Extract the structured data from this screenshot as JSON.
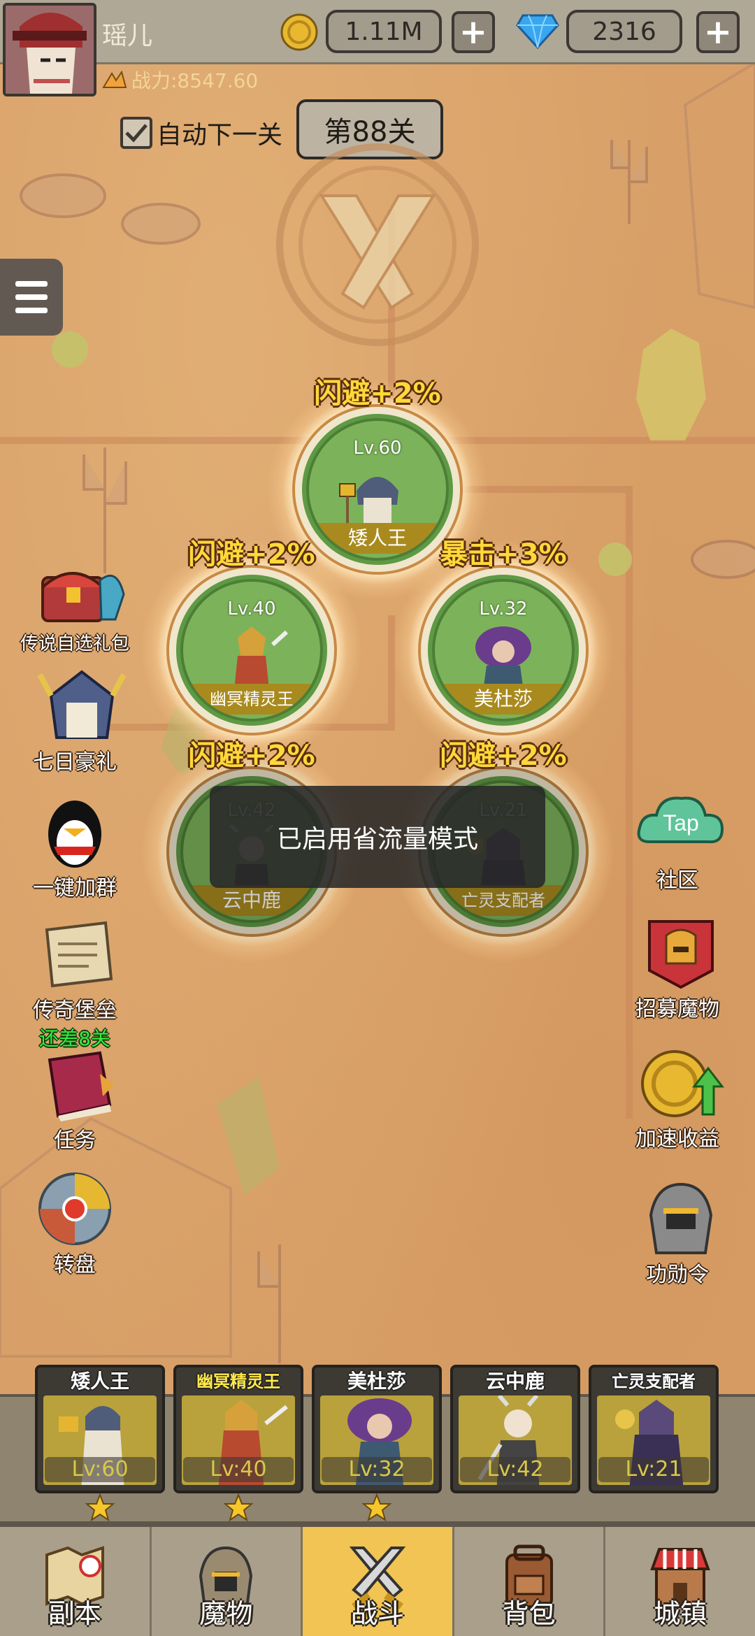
{
  "player": {
    "name": "瑶儿",
    "power_label": "战力:8547.60"
  },
  "currency": {
    "gold": "1.11M",
    "gems": "2316",
    "plus": "+"
  },
  "stage": {
    "auto_next_label": "自动下一关",
    "auto_next_checked": true,
    "current": "第88关"
  },
  "formation": [
    {
      "buff": "闪避+2%",
      "level": "Lv.60",
      "name": "矮人王"
    },
    {
      "buff": "闪避+2%",
      "level": "Lv.40",
      "name": "幽冥精灵王"
    },
    {
      "buff": "暴击+3%",
      "level": "Lv.32",
      "name": "美杜莎"
    },
    {
      "buff": "闪避+2%",
      "level": "Lv.42",
      "name": "云中鹿"
    },
    {
      "buff": "闪避+2%",
      "level": "Lv.21",
      "name": "亡灵支配者"
    }
  ],
  "toast": "已启用省流量模式",
  "left_menu": [
    {
      "label": "传说自选礼包",
      "icon": "treasure-chest-icon"
    },
    {
      "label": "七日豪礼",
      "icon": "knight-helmet-icon"
    },
    {
      "label": "一键加群",
      "icon": "penguin-icon"
    },
    {
      "label": "传奇堡垒",
      "sub": "还差8关",
      "icon": "scroll-map-icon"
    },
    {
      "label": "任务",
      "icon": "quest-book-icon"
    },
    {
      "label": "转盘",
      "icon": "wheel-icon"
    }
  ],
  "right_menu": [
    {
      "label": "社区",
      "icon": "tap-cloud-icon",
      "icon_text": "Tap"
    },
    {
      "label": "招募魔物",
      "icon": "banner-helmet-icon"
    },
    {
      "label": "加速收益",
      "icon": "coin-arrow-icon"
    },
    {
      "label": "功勋令",
      "icon": "warrior-helmet-icon"
    }
  ],
  "roster": [
    {
      "name": "矮人王",
      "level": "Lv:60",
      "stars": 1
    },
    {
      "name": "幽冥精灵王",
      "level": "Lv:40",
      "stars": 1
    },
    {
      "name": "美杜莎",
      "level": "Lv:32",
      "stars": 1
    },
    {
      "name": "云中鹿",
      "level": "Lv:42",
      "stars": 0
    },
    {
      "name": "亡灵支配者",
      "level": "Lv:21",
      "stars": 0
    }
  ],
  "bottom_nav": [
    {
      "label": "副本",
      "icon": "treasure-map-icon"
    },
    {
      "label": "魔物",
      "icon": "monster-helmet-icon"
    },
    {
      "label": "战斗",
      "icon": "crossed-swords-icon",
      "active": true
    },
    {
      "label": "背包",
      "icon": "backpack-icon"
    },
    {
      "label": "城镇",
      "icon": "shop-building-icon"
    }
  ],
  "colors": {
    "map_bg": "#d8a068",
    "active_tab": "#f1c453",
    "buff_text": "#ffd83a",
    "slot_green": "#7cb35a"
  }
}
